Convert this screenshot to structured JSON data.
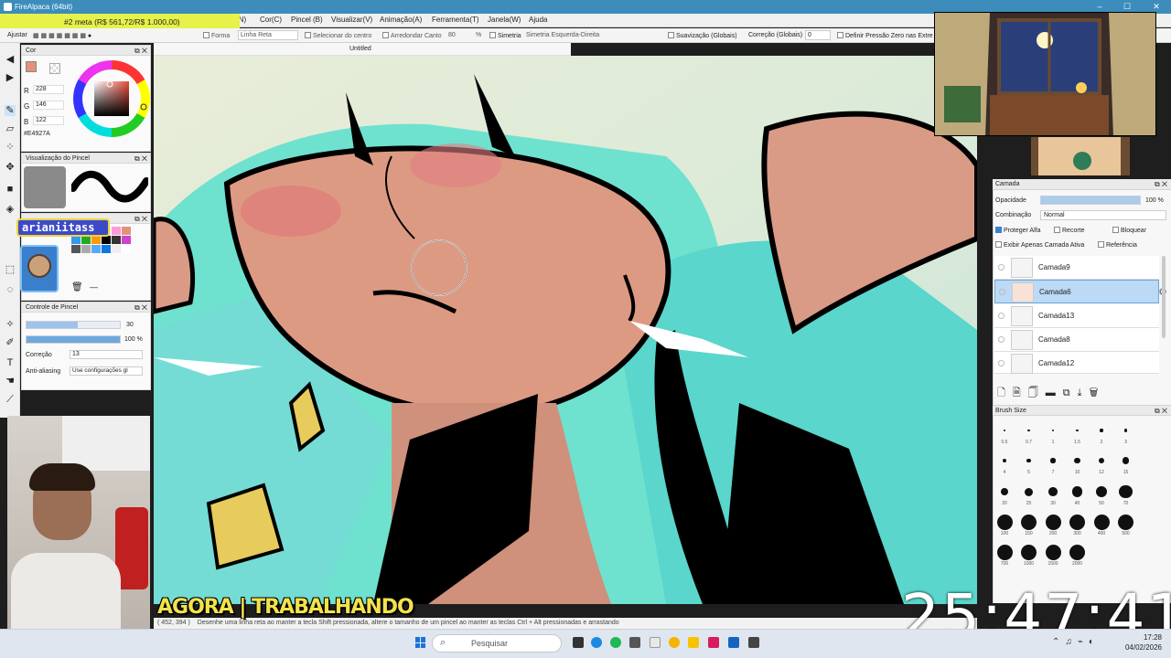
{
  "window": {
    "title": "FireAlpaca (64bit)",
    "minimize": "–",
    "maximize": "☐",
    "close": "✕"
  },
  "goal_banner": "#2 meta (R$ 561,72/R$ 1.000,00)",
  "menu": {
    "items": [
      {
        "label": "(N)"
      },
      {
        "label": "Cor(C)"
      },
      {
        "label": "Pincel (B)"
      },
      {
        "label": "Visualizar(V)"
      },
      {
        "label": "Animação(A)"
      },
      {
        "label": "Ferramenta(T)"
      },
      {
        "label": "Janela(W)"
      },
      {
        "label": "Ajuda"
      }
    ]
  },
  "toolbar": {
    "ajustar": "Ajustar",
    "forma_label": "Forma",
    "forma_value": "Linha Reta",
    "selecionar_centro": "Selecionar do centro",
    "arredondar_canto": "Arredondar Canto",
    "arredondar_value": "80",
    "percent": "%",
    "simetria": "Simetria",
    "simetria_value": "Simetria Esquerda-Direita",
    "suavizacao": "Suavização (Globais)",
    "correcao": "Correção (Globais)",
    "correcao_value": "0",
    "pressao": "Definir Pressão Zero nas Extre"
  },
  "document_tab": "Untitled",
  "color_panel": {
    "title": "Cor",
    "r_label": "R",
    "r_value": "228",
    "g_label": "G",
    "g_value": "146",
    "b_label": "B",
    "b_value": "122",
    "hex": "#E4927A",
    "current_color": "#e4927a"
  },
  "brush_preview_panel": {
    "title": "Visualização do Pincel"
  },
  "stream_badge": "arianiitass",
  "brush_control_panel": {
    "title": "Controle de Pincel",
    "size_value": "30",
    "size_fraction": 0.55,
    "opacity_value": "100 %",
    "opacity_fraction": 1.0,
    "correcao_label": "Correção",
    "correcao_value": "13",
    "antialias_label": "Anti-aliasing",
    "antialias_value": "Use configurações gl"
  },
  "layer_panel": {
    "title": "Camada",
    "opacity_label": "Opacidade",
    "opacity_value": "100 %",
    "opacity_fraction": 1.0,
    "blend_label": "Combinação",
    "blend_value": "Normal",
    "protect_alpha": "Proteger Alfa",
    "clipping": "Recorte",
    "lock": "Bloquear",
    "show_active_only": "Exibir Apenas Camada Ativa",
    "reference": "Referência",
    "layers": [
      {
        "name": "Camada9",
        "selected": false
      },
      {
        "name": "Camada6",
        "selected": true
      },
      {
        "name": "Camada13",
        "selected": false
      },
      {
        "name": "Camada8",
        "selected": false
      },
      {
        "name": "Camada12",
        "selected": false
      }
    ]
  },
  "brush_size_panel": {
    "title": "Brush Size",
    "sizes": [
      "0.5",
      "0.7",
      "1",
      "1.5",
      "2",
      "3",
      "4",
      "5",
      "7",
      "10",
      "12",
      "15",
      "20",
      "25",
      "30",
      "40",
      "50",
      "70",
      "100",
      "150",
      "200",
      "300",
      "400",
      "500",
      "700",
      "1000",
      "1500",
      "2000"
    ]
  },
  "status_bar": {
    "coords": "( 452, 394 )",
    "hint": "Desenhe uma linha reta ao manter a tecla Shift pressionada, altere o tamanho de um pincel ao manter as teclas Ctrl + Alt pressionadas e arrastando"
  },
  "overlay": {
    "working_label": "AGORA | TRABALHANDO",
    "big_clock": "25:47:41"
  },
  "taskbar": {
    "search_placeholder": "Pesquisar",
    "time": "17:28",
    "date": "04/02/2026"
  }
}
